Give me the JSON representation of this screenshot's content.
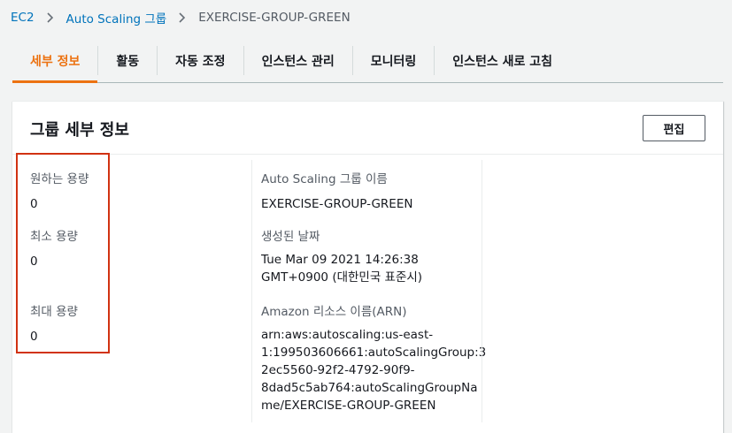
{
  "breadcrumb": {
    "items": [
      "EC2",
      "Auto Scaling 그룹"
    ],
    "current": "EXERCISE-GROUP-GREEN"
  },
  "tabs": [
    {
      "label": "세부 정보",
      "active": true
    },
    {
      "label": "활동",
      "active": false
    },
    {
      "label": "자동 조정",
      "active": false
    },
    {
      "label": "인스턴스 관리",
      "active": false
    },
    {
      "label": "모니터링",
      "active": false
    },
    {
      "label": "인스턴스 새로 고침",
      "active": false
    }
  ],
  "panel": {
    "title": "그룹 세부 정보",
    "edit_label": "편집"
  },
  "fields": {
    "desired": {
      "label": "원하는 용량",
      "value": "0"
    },
    "min": {
      "label": "최소 용량",
      "value": "0"
    },
    "max": {
      "label": "최대 용량",
      "value": "0"
    },
    "group_name": {
      "label": "Auto Scaling 그룹 이름",
      "value": "EXERCISE-GROUP-GREEN"
    },
    "created": {
      "label": "생성된 날짜",
      "lines": [
        "Tue Mar 09 2021 14:26:38",
        "GMT+0900 (대한민국 표준시)"
      ]
    },
    "arn": {
      "label": "Amazon 리소스 이름(ARN)",
      "lines": [
        "arn:aws:autoscaling:us-east-",
        "1:199503606661:autoScalingGroup:3",
        "2ec5560-92f2-4792-90f9-",
        "8dad5c5ab764:autoScalingGroupNa",
        "me/EXERCISE-GROUP-GREEN"
      ]
    }
  },
  "colors": {
    "accent": "#ec7211",
    "link": "#0073bb",
    "highlight": "#d13212"
  }
}
